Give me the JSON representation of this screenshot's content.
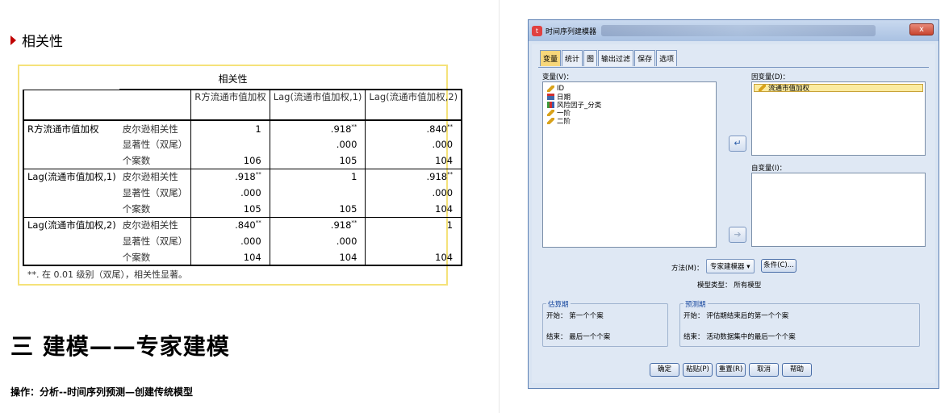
{
  "doc": {
    "section_heading": "相关性",
    "big_title": "三 建模——专家建模",
    "ops_text": "操作：分析--时间序列预测—创建传统模型"
  },
  "corr_table": {
    "title": "相关性",
    "col_headers": [
      "R方流通市值加权",
      "Lag(流通市值加权,1)",
      "Lag(流通市值加权,2)"
    ],
    "stat_labels": [
      "皮尔逊相关性",
      "显著性（双尾）",
      "个案数"
    ],
    "rows": [
      {
        "name": "R方流通市值加权",
        "pearson": [
          "1",
          ".918",
          ".840"
        ],
        "pearson_marks": [
          "",
          "**",
          "**"
        ],
        "sig": [
          "",
          ".000",
          ".000"
        ],
        "n": [
          "106",
          "105",
          "104"
        ]
      },
      {
        "name": "Lag(流通市值加权,1)",
        "pearson": [
          ".918",
          "1",
          ".918"
        ],
        "pearson_marks": [
          "**",
          "",
          "**"
        ],
        "sig": [
          ".000",
          "",
          ".000"
        ],
        "n": [
          "105",
          "105",
          "104"
        ]
      },
      {
        "name": "Lag(流通市值加权,2)",
        "pearson": [
          ".840",
          ".918",
          "1"
        ],
        "pearson_marks": [
          "**",
          "**",
          ""
        ],
        "sig": [
          ".000",
          ".000",
          ""
        ],
        "n": [
          "104",
          "104",
          "104"
        ]
      }
    ],
    "footnote": "**. 在 0.01 级别（双尾），相关性显著。"
  },
  "dialog": {
    "title": "时间序列建模器",
    "close_label": "x",
    "tabs": [
      {
        "label": "变量",
        "active": true
      },
      {
        "label": "统计",
        "active": false
      },
      {
        "label": "图",
        "active": false
      },
      {
        "label": "输出过滤",
        "active": false
      },
      {
        "label": "保存",
        "active": false
      },
      {
        "label": "选项",
        "active": false
      }
    ],
    "variables_label": "变量(V)：",
    "variables": [
      {
        "label": "ID",
        "icon": "scale-icon"
      },
      {
        "label": "日期",
        "icon": "date-icon"
      },
      {
        "label": "风险因子_分类",
        "icon": "nominal-icon"
      },
      {
        "label": "一阶",
        "icon": "scale-icon"
      },
      {
        "label": "二阶",
        "icon": "scale-icon"
      }
    ],
    "dependent_label": "因变量(D)：",
    "dependent_items": [
      {
        "label": "流通市值加权",
        "icon": "scale-icon"
      }
    ],
    "independent_label": "自变量(I)：",
    "method_label": "方法(M)：",
    "method_value": "专家建模器",
    "conditions_button": "条件(C)...",
    "model_type_label": "模型类型：",
    "model_type_value": "所有模型",
    "estimation": {
      "legend": "估算期",
      "start_label": "开始：",
      "start_value": "第一个个案",
      "end_label": "结束：",
      "end_value": "最后一个个案"
    },
    "forecast": {
      "legend": "预测期",
      "start_label": "开始：",
      "start_value": "评估期结束后的第一个个案",
      "end_label": "结束：",
      "end_value": "活动数据集中的最后一个个案"
    },
    "buttons": {
      "ok": "确定",
      "paste": "粘贴(P)",
      "reset": "重置(R)",
      "cancel": "取消",
      "help": "帮助"
    }
  }
}
